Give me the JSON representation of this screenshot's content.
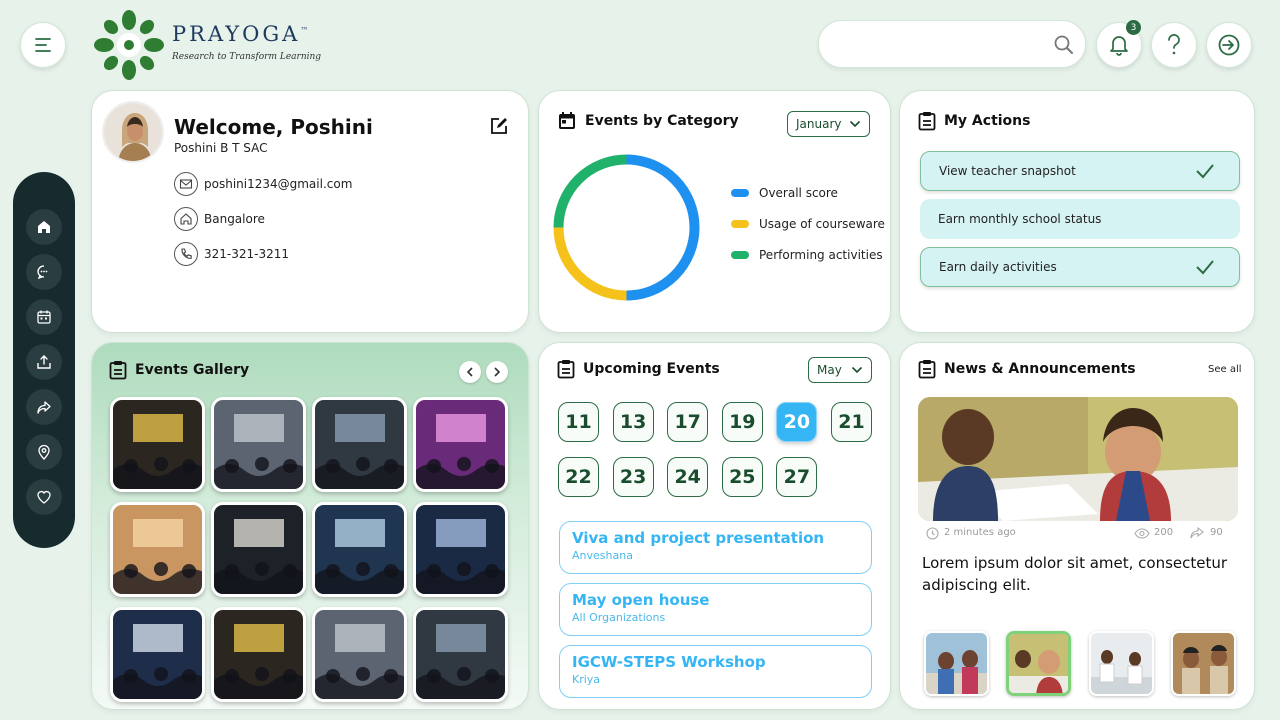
{
  "brand": {
    "name": "PRAYOGA",
    "tm": "™",
    "tagline": "Research to Transform Learning"
  },
  "header": {
    "search_placeholder": "",
    "notification_count": "3"
  },
  "profile": {
    "welcome": "Welcome, Poshini",
    "subtitle": "Poshini B T SAC",
    "email": "poshini1234@gmail.com",
    "location": "Bangalore",
    "phone": "321-321-3211"
  },
  "events_by_category": {
    "title": "Events by Category",
    "month": "January",
    "legend": [
      {
        "label": "Overall score",
        "color": "#1e90f0"
      },
      {
        "label": "Usage of courseware",
        "color": "#f5c21b"
      },
      {
        "label": "Performing activities",
        "color": "#20b26b"
      }
    ]
  },
  "chart_data": {
    "type": "pie",
    "categories": [
      "Overall score",
      "Usage of courseware",
      "Performing activities"
    ],
    "values": [
      50,
      25,
      25
    ]
  },
  "my_actions": {
    "title": "My Actions",
    "items": [
      {
        "label": "View teacher snapshot",
        "done": true
      },
      {
        "label": "Earn monthly school status",
        "done": false
      },
      {
        "label": "Earn daily activities",
        "done": true
      }
    ]
  },
  "gallery": {
    "title": "Events Gallery"
  },
  "upcoming": {
    "title": "Upcoming Events",
    "month": "May",
    "dates": [
      "11",
      "13",
      "17",
      "19",
      "20",
      "21",
      "22",
      "23",
      "24",
      "25",
      "27"
    ],
    "selected": "20",
    "events": [
      {
        "title": "Viva and project presentation",
        "org": "Anveshana"
      },
      {
        "title": "May open house",
        "org": "All Organizations"
      },
      {
        "title": "IGCW-STEPS Workshop",
        "org": "Kriya"
      }
    ]
  },
  "news": {
    "title": "News & Announcements",
    "see_all": "See all",
    "time": "2 minutes ago",
    "views": "200",
    "shares": "90",
    "headline": "Lorem ipsum dolor sit amet, consectetur adipiscing elit."
  },
  "colors": {
    "brand_green": "#2c6b43",
    "accent_blue": "#35b5f3",
    "rail_dark": "#172a2e"
  }
}
